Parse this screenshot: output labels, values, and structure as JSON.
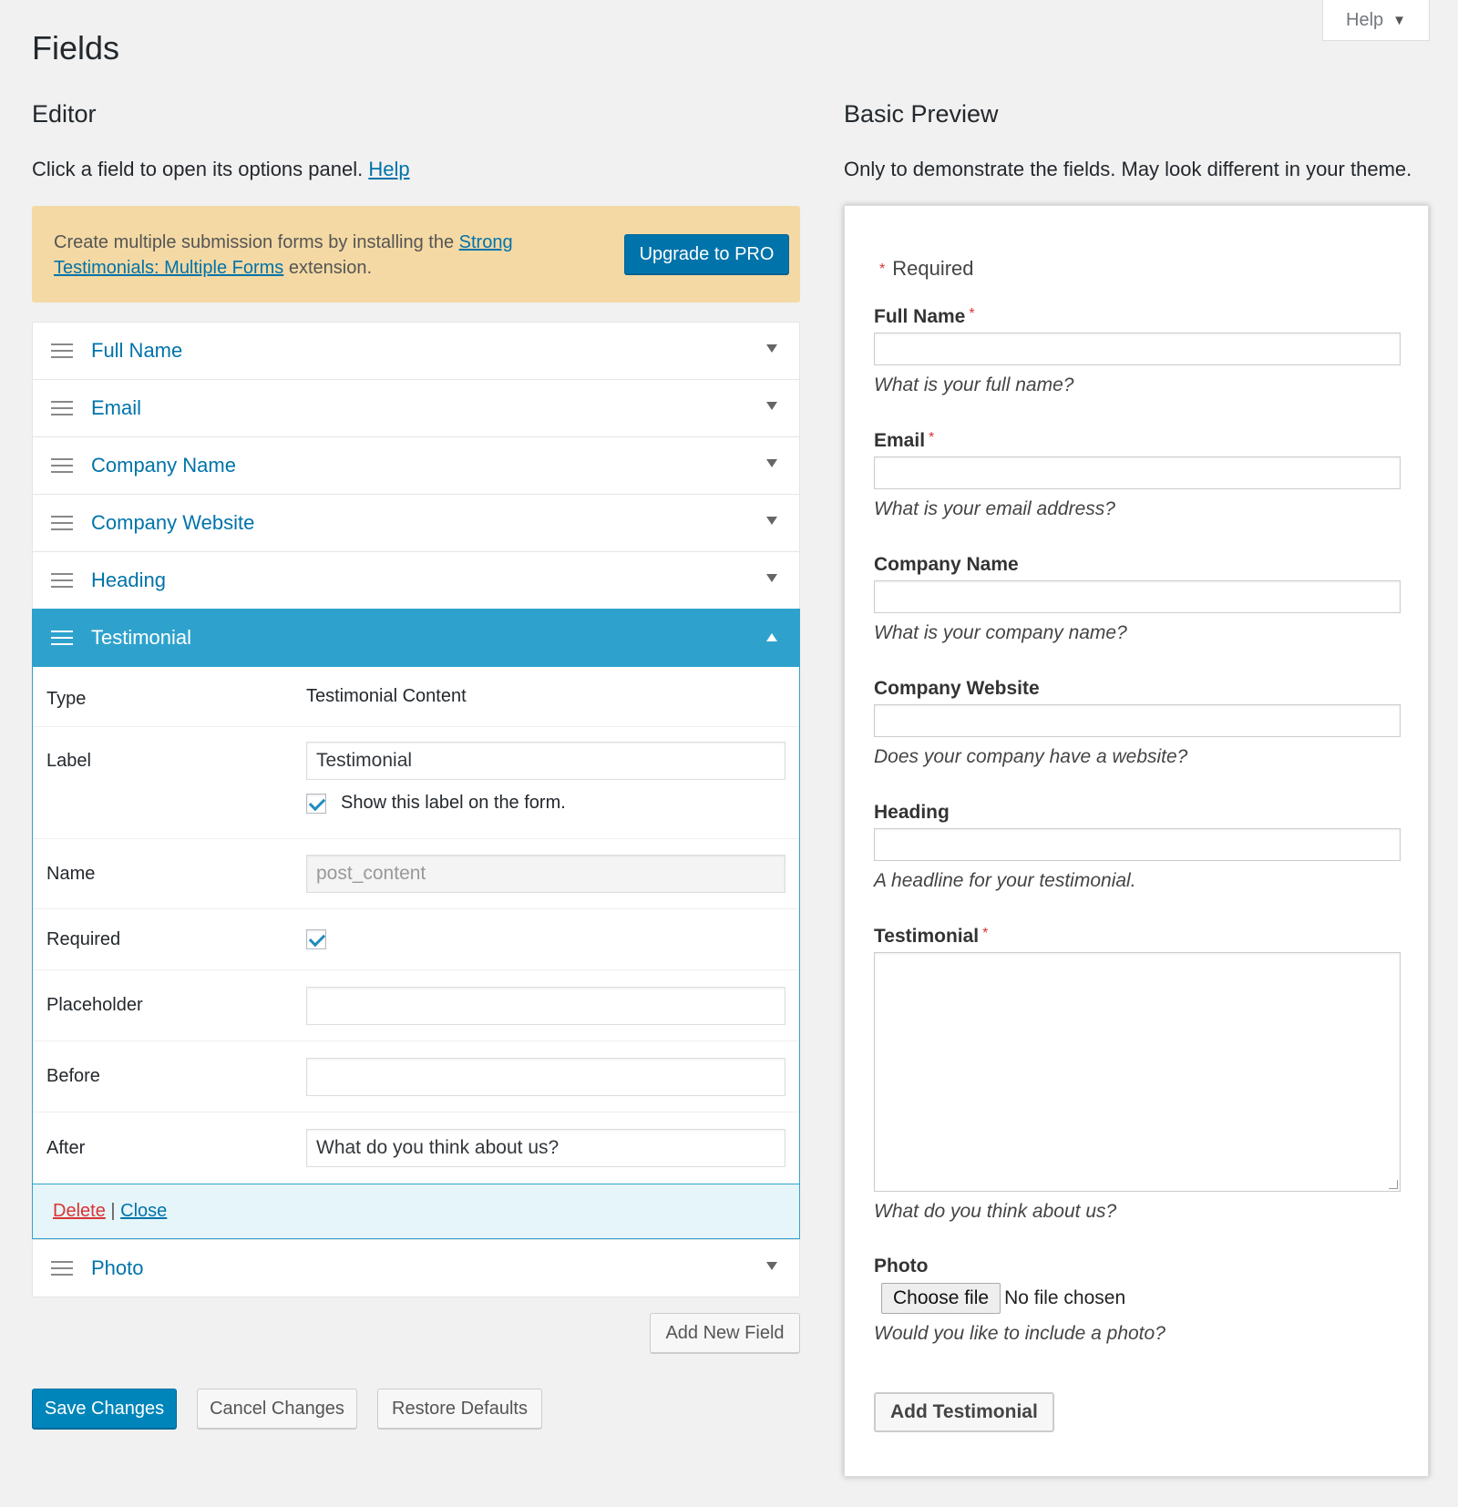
{
  "help_tab": {
    "label": "Help"
  },
  "page_title": "Fields",
  "editor": {
    "heading": "Editor",
    "intro_text": "Click a field to open its options panel.",
    "intro_link": "Help",
    "notice": {
      "text_before": "Create multiple submission forms by installing the",
      "link": "Strong Testimonials: Multiple Forms",
      "text_after": "extension.",
      "button": "Upgrade to PRO"
    },
    "fields": [
      {
        "label": "Full Name"
      },
      {
        "label": "Email"
      },
      {
        "label": "Company Name"
      },
      {
        "label": "Company Website"
      },
      {
        "label": "Heading"
      },
      {
        "label": "Testimonial"
      },
      {
        "label": "Photo"
      }
    ],
    "panel": {
      "type_label": "Type",
      "type_value": "Testimonial Content",
      "label_label": "Label",
      "label_value": "Testimonial",
      "show_label_text": "Show this label on the form.",
      "show_label_checked": true,
      "name_label": "Name",
      "name_value": "post_content",
      "required_label": "Required",
      "required_checked": true,
      "placeholder_label": "Placeholder",
      "placeholder_value": "",
      "before_label": "Before",
      "before_value": "",
      "after_label": "After",
      "after_value": "What do you think about us?",
      "delete": "Delete",
      "separator": "|",
      "close": "Close"
    },
    "add_new_field": "Add New Field",
    "save_changes": "Save Changes",
    "cancel_changes": "Cancel Changes",
    "restore_defaults": "Restore Defaults"
  },
  "preview": {
    "heading": "Basic Preview",
    "intro": "Only to demonstrate the fields. May look different in your theme.",
    "required_note": "Required",
    "star": "*",
    "fields": [
      {
        "label": "Full Name",
        "hint": "What is your full name?"
      },
      {
        "label": "Email",
        "hint": "What is your email address?"
      },
      {
        "label": "Company Name",
        "hint": "What is your company name?"
      },
      {
        "label": "Company Website",
        "hint": "Does your company have a website?"
      },
      {
        "label": "Heading",
        "hint": "A headline for your testimonial."
      },
      {
        "label": "Testimonial",
        "hint": "What do you think about us?"
      },
      {
        "label": "Photo",
        "hint": "Would you like to include a photo?"
      }
    ],
    "file_button": "Choose file",
    "file_status": "No file chosen",
    "submit": "Add Testimonial"
  },
  "colors": {
    "accent": "#0073aa",
    "open_row": "#2ea2cc",
    "notice_bg": "#f4d9a4",
    "required_star": "#dc3232"
  }
}
